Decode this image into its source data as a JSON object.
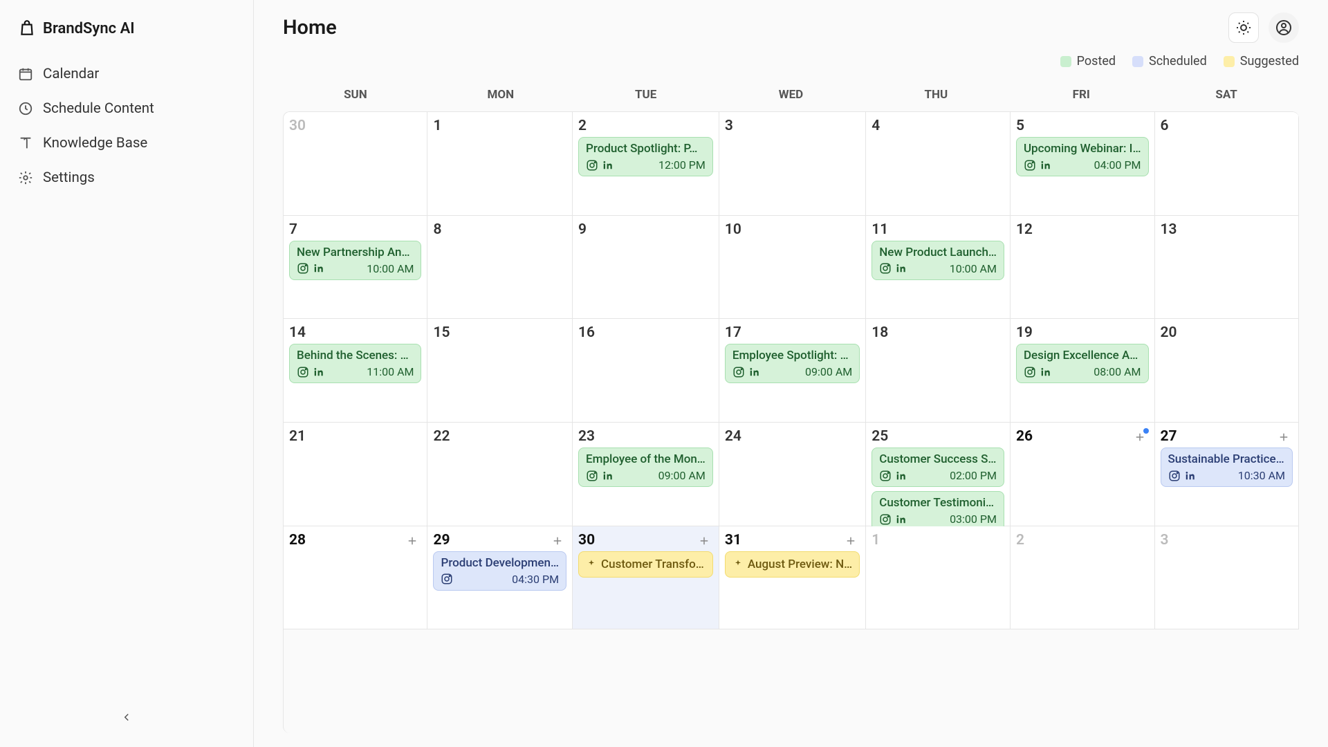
{
  "app": {
    "name": "BrandSync AI"
  },
  "sidebar": {
    "items": [
      {
        "label": "Calendar"
      },
      {
        "label": "Schedule Content"
      },
      {
        "label": "Knowledge Base"
      },
      {
        "label": "Settings"
      }
    ]
  },
  "header": {
    "title": "Home"
  },
  "legend": {
    "posted": {
      "label": "Posted",
      "color": "#c9efcf"
    },
    "scheduled": {
      "label": "Scheduled",
      "color": "#d6defa"
    },
    "suggested": {
      "label": "Suggested",
      "color": "#fdeea8"
    }
  },
  "weekdays": [
    "SUN",
    "MON",
    "TUE",
    "WED",
    "THU",
    "FRI",
    "SAT"
  ],
  "cells": [
    {
      "num": "30",
      "cls": "pastmonth"
    },
    {
      "num": "1",
      "cls": "current"
    },
    {
      "num": "2",
      "cls": "current",
      "events": [
        {
          "type": "posted",
          "title": "Product Spotlight: P…",
          "time": "12:00 PM",
          "icons": [
            "instagram",
            "linkedin"
          ]
        }
      ]
    },
    {
      "num": "3",
      "cls": "current"
    },
    {
      "num": "4",
      "cls": "current"
    },
    {
      "num": "5",
      "cls": "current",
      "events": [
        {
          "type": "posted",
          "title": "Upcoming Webinar: I…",
          "time": "04:00 PM",
          "icons": [
            "instagram",
            "linkedin"
          ]
        }
      ]
    },
    {
      "num": "6",
      "cls": "current"
    },
    {
      "num": "7",
      "cls": "current",
      "events": [
        {
          "type": "posted",
          "title": "New Partnership An…",
          "time": "10:00 AM",
          "icons": [
            "instagram",
            "linkedin"
          ]
        }
      ]
    },
    {
      "num": "8",
      "cls": "current"
    },
    {
      "num": "9",
      "cls": "current"
    },
    {
      "num": "10",
      "cls": "current"
    },
    {
      "num": "11",
      "cls": "current",
      "events": [
        {
          "type": "posted",
          "title": "New Product Launch…",
          "time": "10:00 AM",
          "icons": [
            "instagram",
            "linkedin"
          ]
        }
      ]
    },
    {
      "num": "12",
      "cls": "current"
    },
    {
      "num": "13",
      "cls": "current"
    },
    {
      "num": "14",
      "cls": "current",
      "events": [
        {
          "type": "posted",
          "title": "Behind the Scenes: …",
          "time": "11:00 AM",
          "icons": [
            "instagram",
            "linkedin"
          ]
        }
      ]
    },
    {
      "num": "15",
      "cls": "current"
    },
    {
      "num": "16",
      "cls": "current"
    },
    {
      "num": "17",
      "cls": "current",
      "events": [
        {
          "type": "posted",
          "title": "Employee Spotlight: …",
          "time": "09:00 AM",
          "icons": [
            "instagram",
            "linkedin"
          ]
        }
      ]
    },
    {
      "num": "18",
      "cls": "current"
    },
    {
      "num": "19",
      "cls": "current",
      "events": [
        {
          "type": "posted",
          "title": "Design Excellence A…",
          "time": "08:00 AM",
          "icons": [
            "instagram",
            "linkedin"
          ]
        }
      ]
    },
    {
      "num": "20",
      "cls": "current"
    },
    {
      "num": "21",
      "cls": "current"
    },
    {
      "num": "22",
      "cls": "current"
    },
    {
      "num": "23",
      "cls": "current",
      "events": [
        {
          "type": "posted",
          "title": "Employee of the Mon…",
          "time": "09:00 AM",
          "icons": [
            "instagram",
            "linkedin"
          ]
        }
      ]
    },
    {
      "num": "24",
      "cls": "current"
    },
    {
      "num": "25",
      "cls": "current",
      "events": [
        {
          "type": "posted",
          "title": "Customer Success S…",
          "time": "02:00 PM",
          "icons": [
            "instagram",
            "linkedin"
          ]
        },
        {
          "type": "posted",
          "title": "Customer Testimoni…",
          "time": "03:00 PM",
          "icons": [
            "instagram",
            "linkedin"
          ]
        }
      ]
    },
    {
      "num": "26",
      "cls": "future today-bold",
      "add": true,
      "addDot": true
    },
    {
      "num": "27",
      "cls": "future today-bold",
      "add": true,
      "events": [
        {
          "type": "scheduled",
          "title": "Sustainable Practice…",
          "time": "10:30 AM",
          "icons": [
            "instagram",
            "linkedin"
          ]
        }
      ]
    },
    {
      "num": "28",
      "cls": "future today-bold",
      "add": true
    },
    {
      "num": "29",
      "cls": "future today-bold",
      "add": true,
      "events": [
        {
          "type": "scheduled",
          "title": "Product Developmen…",
          "time": "04:30 PM",
          "icons": [
            "instagram"
          ]
        }
      ]
    },
    {
      "num": "30",
      "cls": "today future today-bold",
      "add": true,
      "events": [
        {
          "type": "suggested",
          "title": "Customer Transfo…"
        }
      ]
    },
    {
      "num": "31",
      "cls": "future today-bold",
      "add": true,
      "events": [
        {
          "type": "suggested",
          "title": "August Preview: N…"
        }
      ]
    },
    {
      "num": "1",
      "cls": "nextmonth"
    },
    {
      "num": "2",
      "cls": "nextmonth"
    },
    {
      "num": "3",
      "cls": "nextmonth"
    }
  ]
}
